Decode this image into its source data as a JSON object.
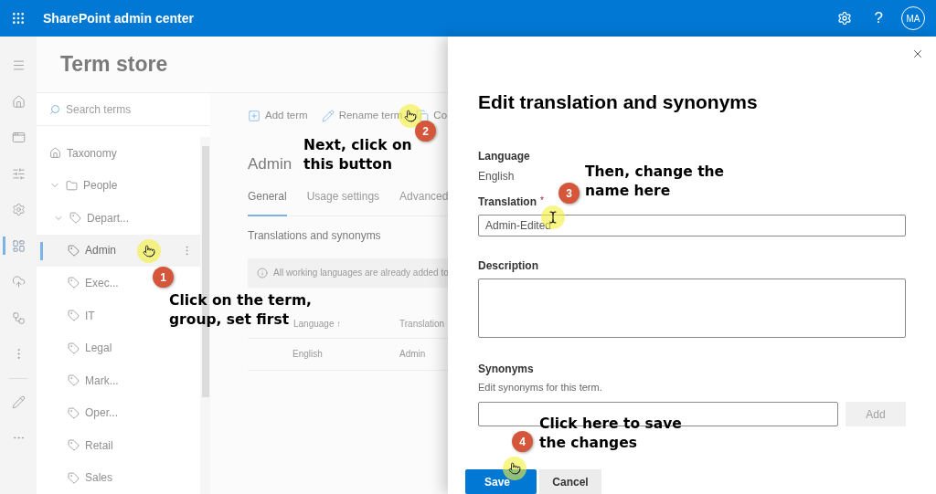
{
  "top_bar": {
    "title": "SharePoint admin center",
    "help": "?",
    "avatar": "MA"
  },
  "rail": [
    {
      "kind": "menu",
      "selected": false
    },
    {
      "kind": "home",
      "selected": false
    },
    {
      "kind": "window",
      "selected": false
    },
    {
      "kind": "sliders",
      "selected": false
    },
    {
      "kind": "settings",
      "selected": false
    },
    {
      "kind": "content",
      "selected": true
    },
    {
      "kind": "cloud",
      "selected": false
    },
    {
      "kind": "connections",
      "selected": false
    },
    {
      "kind": "more-vertical",
      "selected": false
    },
    {
      "kind": "pencil",
      "selected": false
    },
    {
      "kind": "more",
      "selected": false
    }
  ],
  "page_title": "Term store",
  "search": {
    "placeholder": "Search terms"
  },
  "tree": [
    {
      "kind": "home",
      "label": "Taxonomy",
      "selected": false
    },
    {
      "kind": "folder",
      "label": "People",
      "expanded": true,
      "selected": false,
      "children": [
        {
          "kind": "tag",
          "label": "Depart...",
          "expanded": true,
          "selected": false,
          "children": [
            {
              "kind": "tag",
              "label": "Admin",
              "selected": true
            },
            {
              "kind": "tag",
              "label": "Exec...",
              "selected": false
            },
            {
              "kind": "tag",
              "label": "IT",
              "selected": false
            },
            {
              "kind": "tag",
              "label": "Legal",
              "selected": false
            },
            {
              "kind": "tag",
              "label": "Mark...",
              "selected": false
            },
            {
              "kind": "tag",
              "label": "Oper...",
              "selected": false
            },
            {
              "kind": "tag",
              "label": "Retail",
              "selected": false
            },
            {
              "kind": "tag",
              "label": "Sales",
              "selected": false
            }
          ]
        }
      ]
    }
  ],
  "toolbar": [
    {
      "kind": "add",
      "label": "Add term"
    },
    {
      "kind": "rename",
      "label": "Rename term"
    },
    {
      "kind": "copy",
      "label": "Co"
    }
  ],
  "term_title": "Admin",
  "tabs": [
    {
      "label": "General",
      "selected": true
    },
    {
      "label": "Usage settings",
      "selected": false
    },
    {
      "label": "Advanced",
      "selected": false
    }
  ],
  "section_title": "Translations and synonyms",
  "info_message": "All working languages are already added to",
  "table": {
    "columns": [
      "Language ↑",
      "Translation"
    ],
    "rows": [
      [
        "English",
        "Admin"
      ]
    ]
  },
  "panel": {
    "title": "Edit translation and synonyms",
    "language_label": "Language",
    "language_value": "English",
    "translation_label": "Translation",
    "required_mark": "*",
    "translation_value": "Admin-Edited",
    "description_label": "Description",
    "synonyms_label": "Synonyms",
    "synonyms_hint": "Edit synonyms for this term.",
    "add_button": {
      "label": "Add",
      "disabled": true
    },
    "buttons": [
      {
        "kind": "primary",
        "label": "Save"
      },
      {
        "kind": "secondary",
        "label": "Cancel"
      }
    ]
  },
  "annotations": [
    {
      "step": "1",
      "lines": [
        "Click on the term,",
        "group, set first"
      ],
      "kind": "hand"
    },
    {
      "step": "2",
      "lines": [
        "Next, click on",
        "this button"
      ],
      "kind": "hand"
    },
    {
      "step": "3",
      "lines": [
        "Then, change the",
        "name here"
      ],
      "kind": "text"
    },
    {
      "step": "4",
      "lines": [
        "Click here to save",
        "the changes"
      ],
      "kind": "hand"
    }
  ]
}
